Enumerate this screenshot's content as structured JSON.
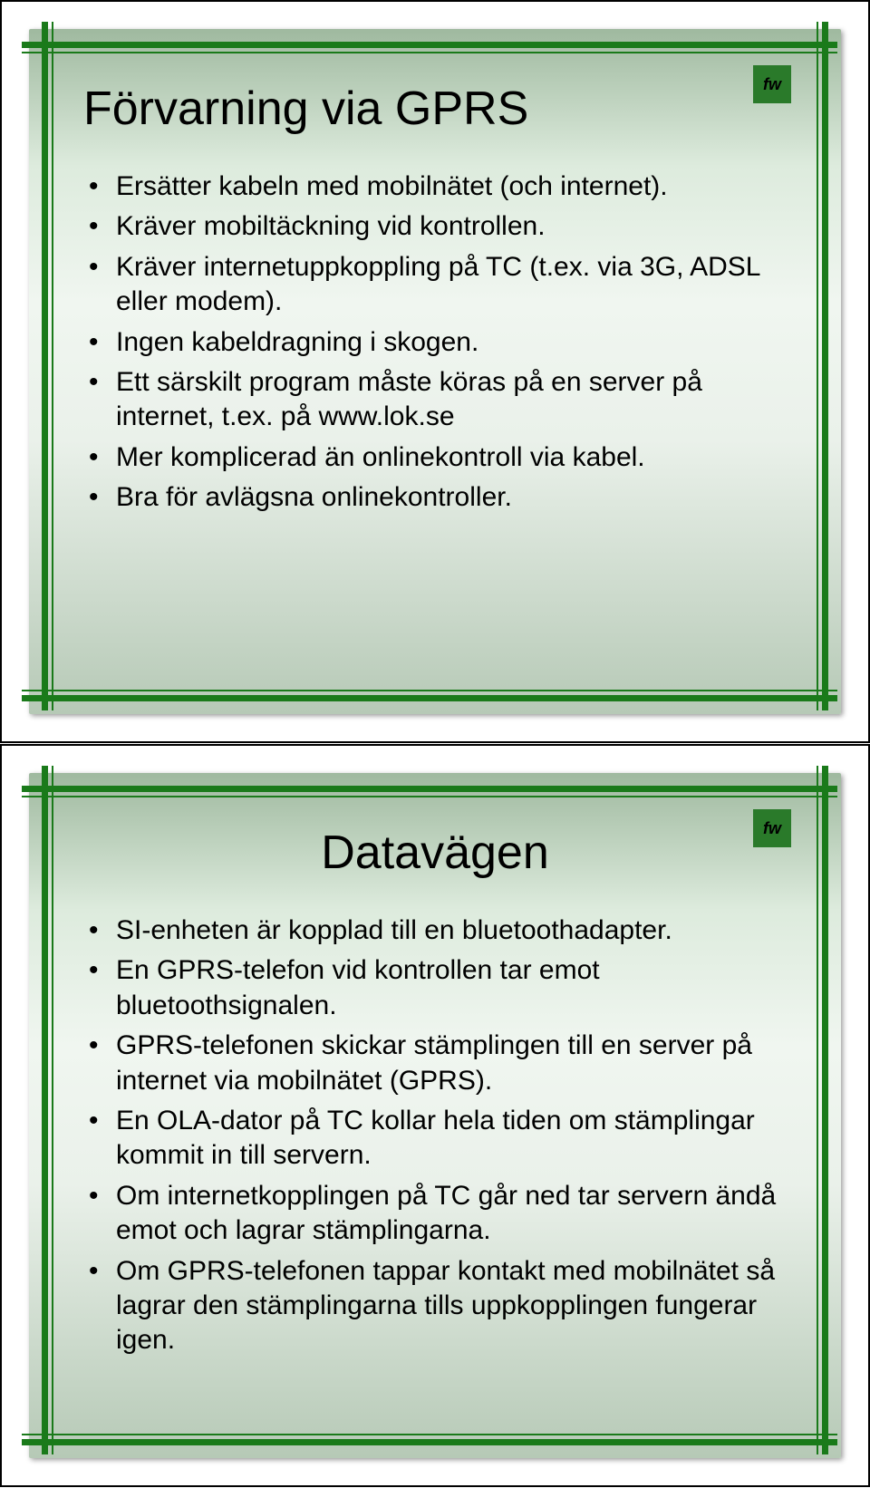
{
  "slides": [
    {
      "title": "Förvarning via GPRS",
      "bullets": [
        "Ersätter kabeln med mobilnätet (och internet).",
        "Kräver mobiltäckning vid kontrollen.",
        "Kräver internetuppkoppling på TC (t.ex. via 3G, ADSL eller modem).",
        "Ingen kabeldragning i skogen.",
        "Ett särskilt program måste köras på en server på internet, t.ex. på www.lok.se",
        "Mer komplicerad än onlinekontroll via kabel.",
        "Bra för avlägsna onlinekontroller."
      ]
    },
    {
      "title": "Datavägen",
      "bullets": [
        "SI-enheten är kopplad till en bluetoothadapter.",
        "En GPRS-telefon vid kontrollen tar emot bluetoothsignalen.",
        "GPRS-telefonen skickar stämplingen till en server på internet via mobilnätet (GPRS).",
        "En OLA-dator på TC kollar hela tiden om stämplingar kommit in till servern.",
        "Om internetkopplingen på TC går ned tar servern ändå emot och lagrar stämplingarna.",
        "Om GPRS-telefonen tappar kontakt med mobilnätet så lagrar den stämplingarna tills uppkopplingen fungerar igen."
      ]
    }
  ],
  "logo_text": "fw"
}
